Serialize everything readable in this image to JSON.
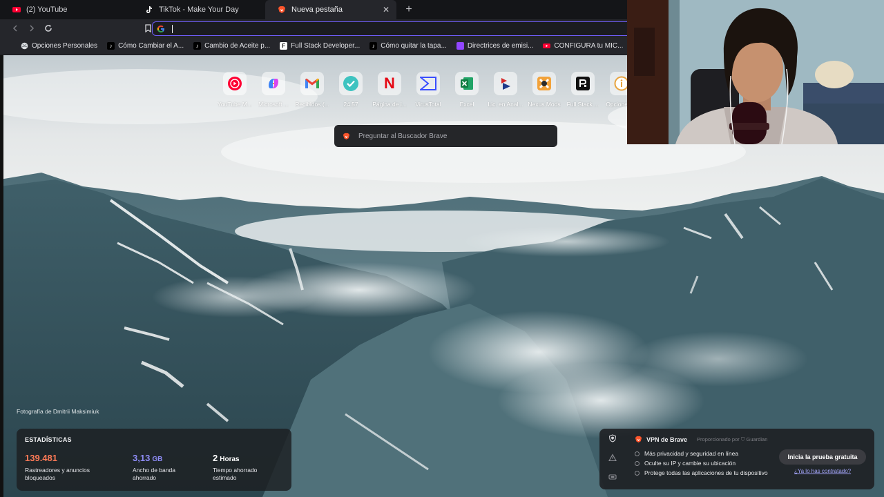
{
  "tabs": [
    {
      "label": "(2) YouTube",
      "icon": "youtube-icon",
      "color": "#ff0033"
    },
    {
      "label": "TikTok - Make Your Day",
      "icon": "tiktok-icon",
      "color": "#ffffff"
    },
    {
      "label": "Nueva pestaña",
      "icon": "brave-lion-icon",
      "color": "#fb542b",
      "active": true
    }
  ],
  "toolbar": {
    "url_value": "",
    "accent": "#6e5cf6"
  },
  "bookmarks": [
    {
      "label": "Opciones Personales",
      "icon": "globe-icon",
      "color": "#9aa0a6"
    },
    {
      "label": "Cómo Cambiar el A...",
      "icon": "tiktok-icon",
      "color": "#000000"
    },
    {
      "label": "Cambio de Aceite p...",
      "icon": "tiktok-icon",
      "color": "#000000"
    },
    {
      "label": "Full Stack Developer...",
      "icon": "f-logo-icon",
      "color": "#111111"
    },
    {
      "label": "Cómo quitar la tapa...",
      "icon": "tiktok-icon",
      "color": "#000000"
    },
    {
      "label": "Directrices de emisi...",
      "icon": "twitch-icon",
      "color": "#9146ff"
    },
    {
      "label": "CONFIGURA tu MIC...",
      "icon": "youtube-icon",
      "color": "#ff0033"
    }
  ],
  "shortcuts": [
    {
      "label": "YouTube M...",
      "icon": "youtube-music-icon",
      "color": "#ff0033"
    },
    {
      "label": "Microsoft ...",
      "icon": "copilot-icon",
      "color": "#5b8def"
    },
    {
      "label": "Recibidos (...",
      "icon": "gmail-icon",
      "color": "#ea4335"
    },
    {
      "label": "24.57",
      "icon": "checkmark-icon",
      "color": "#3ec3c0"
    },
    {
      "label": "Página de i...",
      "icon": "netflix-icon",
      "color": "#e50914"
    },
    {
      "label": "VirusTotal",
      "icon": "virustotal-icon",
      "color": "#394eff"
    },
    {
      "label": "Excel",
      "icon": "excel-icon",
      "color": "#1d7a45"
    },
    {
      "label": "Lic. en Anal...",
      "icon": "play-flag-icon",
      "color": "#1f3a8a"
    },
    {
      "label": "Nexus Mods",
      "icon": "nexus-icon",
      "color": "#f2a23a"
    },
    {
      "label": "Full Stack ...",
      "icon": "r-logo-icon",
      "color": "#111111"
    },
    {
      "label": "Opciones ...",
      "icon": "info-icon",
      "color": "#e8a33d"
    }
  ],
  "search": {
    "placeholder": "Preguntar al Buscador Brave"
  },
  "photo_credit": "Fotografía de Dmitrii Maksimiuk",
  "stats": {
    "title": "ESTADÍSTICAS",
    "items": [
      {
        "value": "139.481",
        "unit": "",
        "desc_line1": "Rastreadores y anuncios",
        "desc_line2": "bloqueados",
        "color": "#ff7a57"
      },
      {
        "value": "3,13",
        "unit": "GB",
        "desc_line1": "Ancho de banda",
        "desc_line2": "ahorrado",
        "color": "#8e8cf6"
      },
      {
        "value": "2",
        "unit": "Horas",
        "desc_line1": "Tiempo ahorrado",
        "desc_line2": "estimado",
        "color": "#ffffff"
      }
    ]
  },
  "vpn": {
    "title": "VPN de Brave",
    "powered_by": "Proporcionado por ⛉ Guardian",
    "features": [
      "Más privacidad y seguridad en línea",
      "Oculte su IP y cambie su ubicación",
      "Protege todas las aplicaciones de tu dispositivo"
    ],
    "cta": "Inicia la prueba gratuita",
    "link": "¿Ya lo has contratado?"
  }
}
